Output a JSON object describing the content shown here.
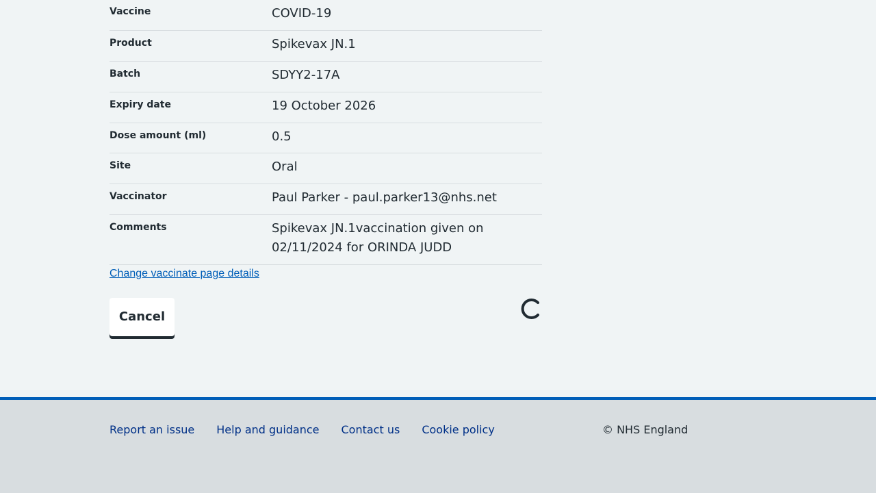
{
  "summary": {
    "rows": [
      {
        "key": "Vaccine",
        "value": "COVID-19"
      },
      {
        "key": "Product",
        "value": "Spikevax JN.1"
      },
      {
        "key": "Batch",
        "value": "SDYY2-17A"
      },
      {
        "key": "Expiry date",
        "value": "19 October 2026"
      },
      {
        "key": "Dose amount (ml)",
        "value": "0.5"
      },
      {
        "key": "Site",
        "value": "Oral"
      },
      {
        "key": "Vaccinator",
        "value": "Paul Parker - paul.parker13@nhs.net"
      },
      {
        "key": "Comments",
        "value": "Spikevax JN.1vaccination given on 02/11/2024 for ORINDA JUDD"
      }
    ],
    "change_link": "Change vaccinate page details"
  },
  "actions": {
    "cancel_label": "Cancel",
    "loading_icon": "spinner-icon"
  },
  "footer": {
    "links": [
      "Report an issue",
      "Help and guidance",
      "Contact us",
      "Cookie policy"
    ],
    "copyright": "© NHS England"
  },
  "colors": {
    "background": "#f0f4f5",
    "link": "#005eb8",
    "footer_background": "#d8dde0",
    "footer_link": "#003087",
    "footer_border": "#005eb8",
    "text": "#212b32"
  }
}
